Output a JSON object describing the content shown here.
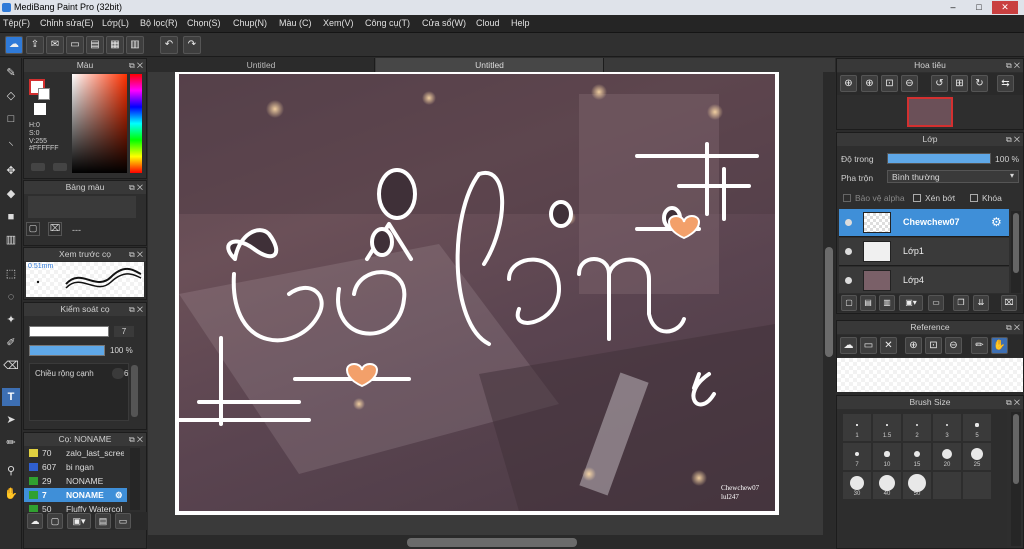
{
  "window": {
    "title": "MediBang Paint Pro (32bit)",
    "min": "–",
    "max": "□",
    "close": "✕"
  },
  "menu": [
    "Tệp(F)",
    "Chỉnh sửa(E)",
    "Lớp(L)",
    "Bộ lọc(R)",
    "Chọn(S)",
    "Chup(N)",
    "Màu (C)",
    "Xem(V)",
    "Công cụ(T)",
    "Cửa sổ(W)",
    "Cloud",
    "Help"
  ],
  "tabs": [
    "Untitled",
    "Untitled"
  ],
  "color_panel": {
    "title": "Màu",
    "h": "H:0",
    "s": "S:0",
    "v": "V:255",
    "hex": "#FFFFFF"
  },
  "palette_panel": {
    "title": "Bảng màu",
    "value": "---"
  },
  "preview_panel": {
    "title": "Xem trước cọ",
    "size": "0.51mm"
  },
  "control_panel": {
    "title": "Kiểm soát cọ",
    "size_value": "7",
    "opacity_value": "100 %",
    "opacity": 1.0,
    "edge_label": "Chiều rộng cạnh",
    "edge_value": "6"
  },
  "brush_panel": {
    "title": "Cọ: NONAME",
    "items": [
      {
        "num": "70",
        "name": "zalo_last_scree",
        "color": "#e0d040"
      },
      {
        "num": "607",
        "name": "bi ngan",
        "color": "#2f5fd0"
      },
      {
        "num": "29",
        "name": "NONAME",
        "color": "#30a030"
      },
      {
        "num": "7",
        "name": "NONAME",
        "color": "#30a030",
        "selected": true
      },
      {
        "num": "50",
        "name": "Fluffy Watercol",
        "color": "#30a030"
      }
    ]
  },
  "navigator": {
    "title": "Hoa tiêu"
  },
  "layer_panel": {
    "title": "Lớp",
    "opacity_label": "Độ trong",
    "opacity_value": "100 %",
    "opacity": 1.0,
    "blend_label": "Pha trộn",
    "blend_value": "Bình thường",
    "protect_alpha": "Bảo vệ alpha",
    "clipping": "Xén bớt",
    "lock": "Khóa",
    "layers": [
      {
        "name": "Chewchew07",
        "selected": true
      },
      {
        "name": "Lớp1",
        "selected": false
      },
      {
        "name": "Lớp4",
        "selected": false
      }
    ]
  },
  "reference_panel": {
    "title": "Reference"
  },
  "brushsize_panel": {
    "title": "Brush Size",
    "labels": [
      "1",
      "1.5",
      "2",
      "3",
      "5",
      "7",
      "10",
      "15",
      "20",
      "25",
      "30",
      "40",
      "50"
    ]
  },
  "artwork": {
    "text": "cô lên",
    "signature_line1": "Chewchew07",
    "signature_line2": "lul247"
  },
  "colors": {
    "accent": "#3f8fd8",
    "panel": "#2e2e2e",
    "dark": "#252525"
  }
}
